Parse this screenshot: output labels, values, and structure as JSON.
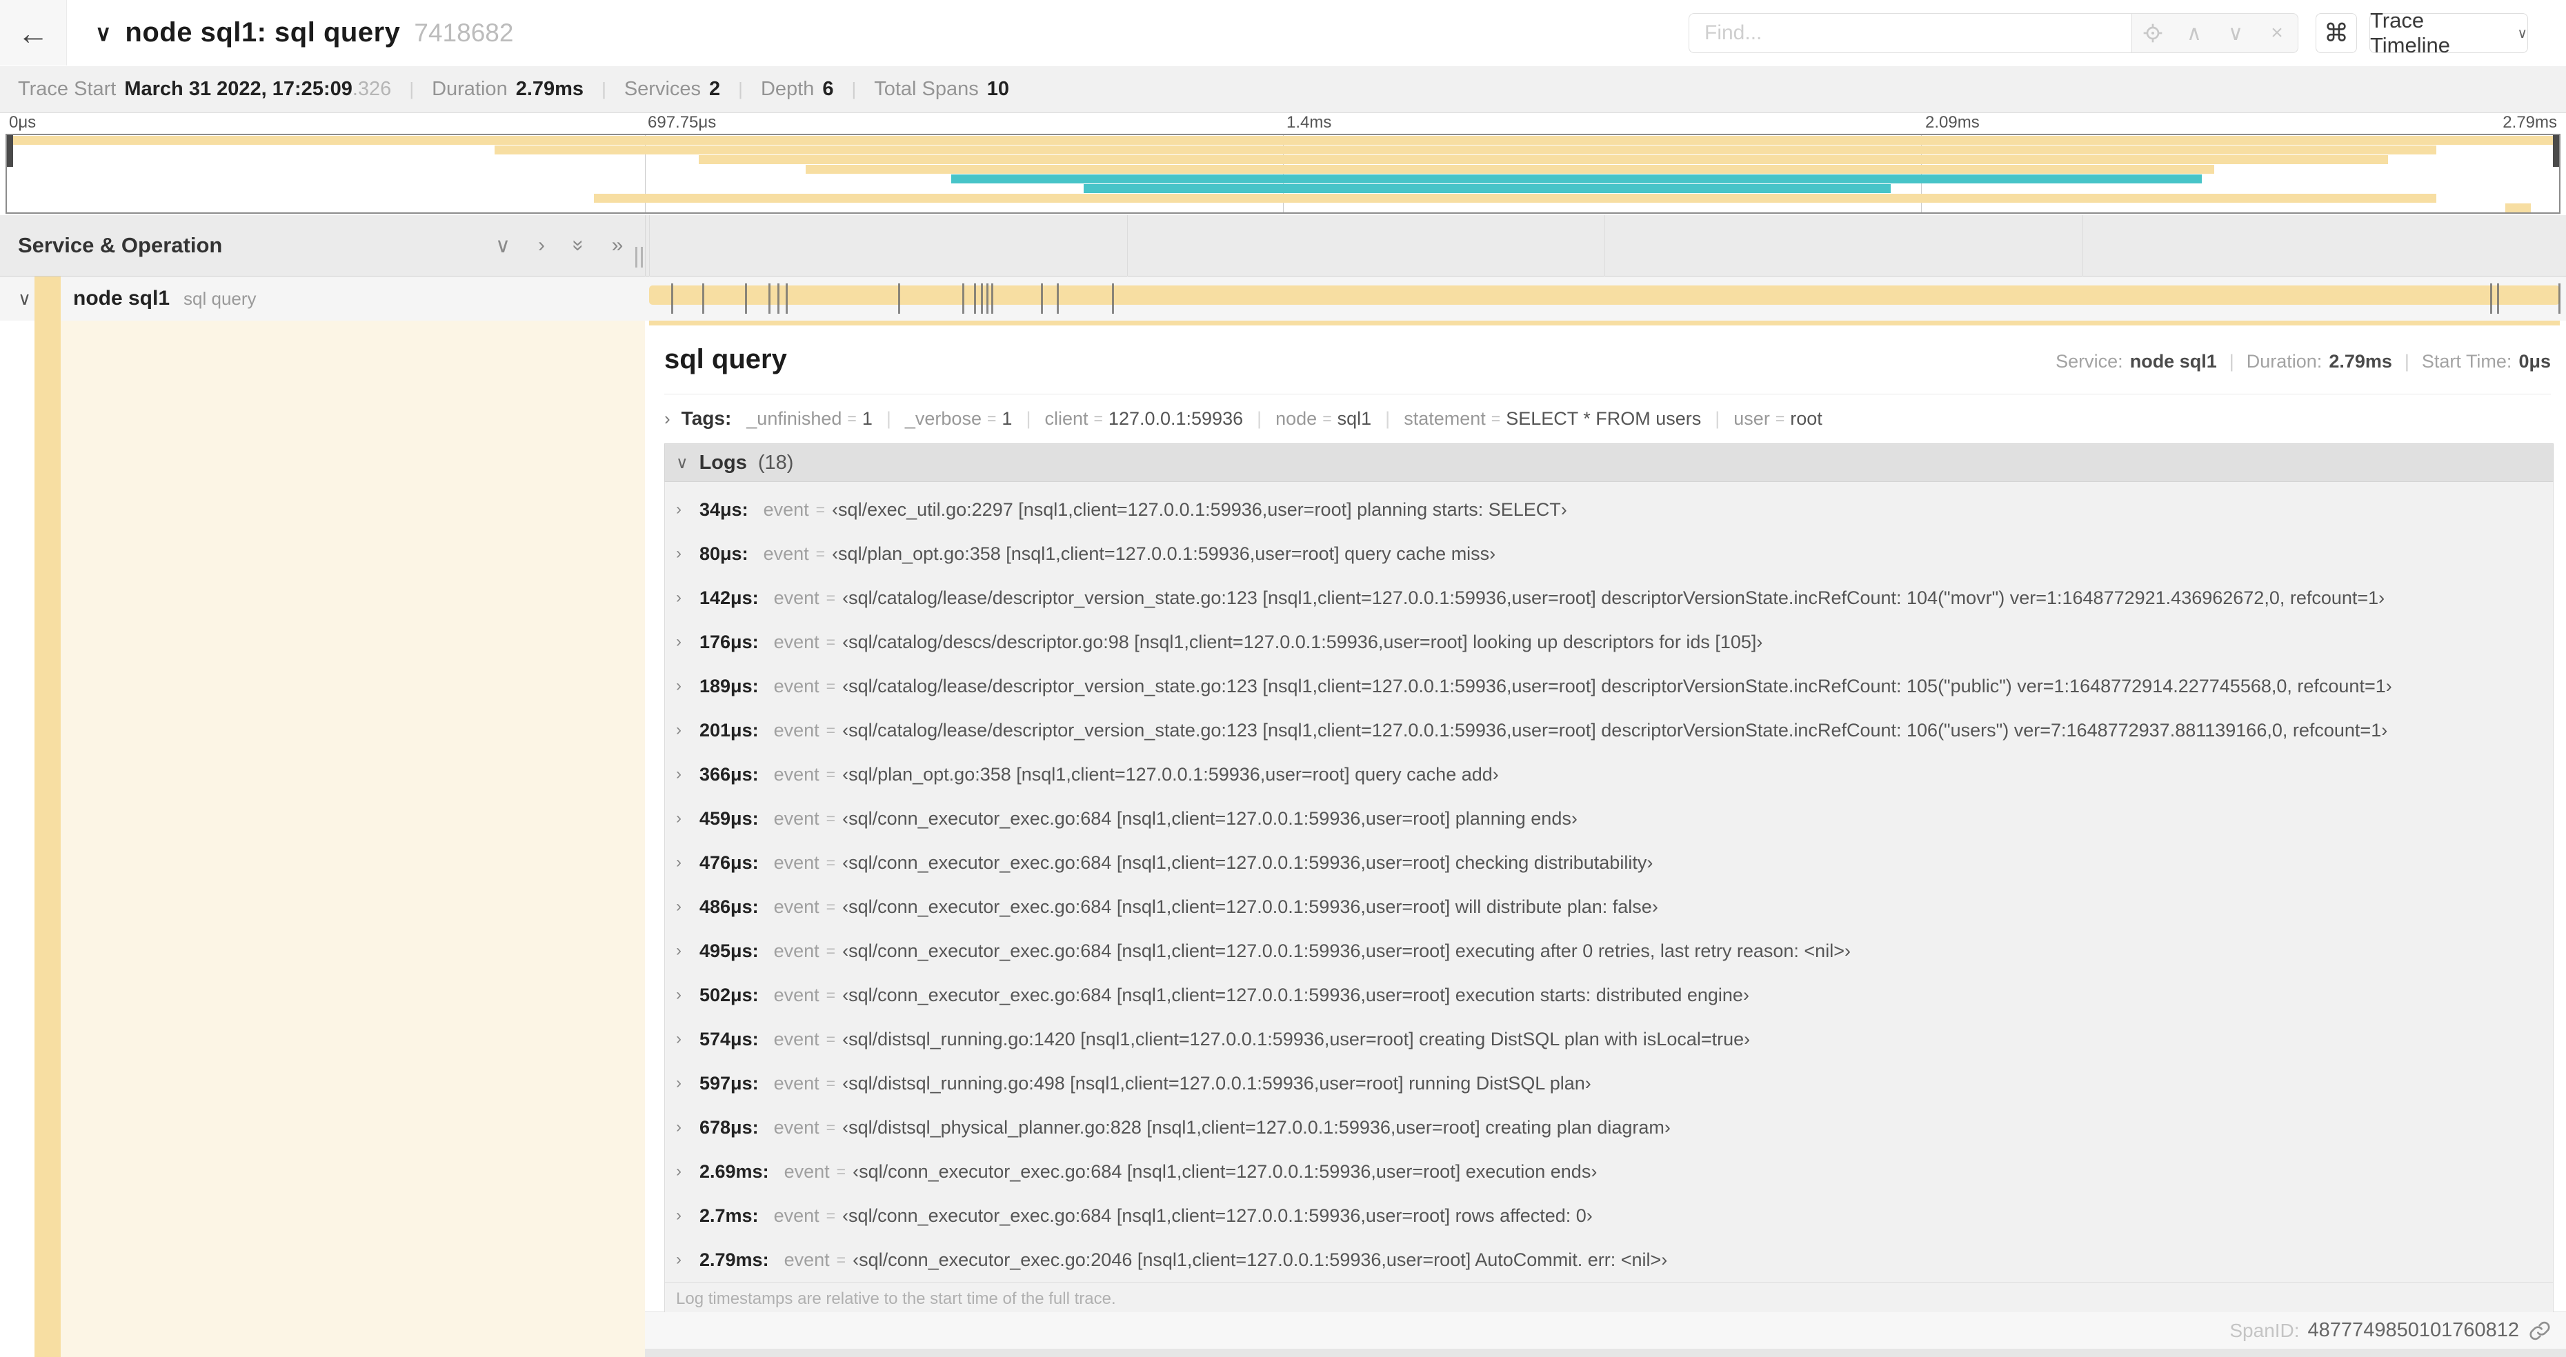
{
  "ui": {
    "sep": "|",
    "eq": "=",
    "back": "←",
    "caret_down": "∨",
    "caret_right": "›",
    "caret_up": "∧",
    "close": "×",
    "double_right": "»",
    "cmd": "⌘"
  },
  "topbar": {
    "title": "node sql1: sql query",
    "trace_id": "7418682",
    "find_placeholder": "Find...",
    "view_selector": "Trace Timeline"
  },
  "trace_summary": {
    "trace_start_label": "Trace Start",
    "trace_start_value": "March 31 2022, 17:25:09",
    "trace_start_suffix": ".326",
    "duration_label": "Duration",
    "duration_value": "2.79ms",
    "services_label": "Services",
    "services_value": "2",
    "depth_label": "Depth",
    "depth_value": "6",
    "total_spans_label": "Total Spans",
    "total_spans_value": "10"
  },
  "timeline": {
    "ticks": [
      "0μs",
      "697.75μs",
      "1.4ms",
      "2.09ms",
      "2.79ms"
    ],
    "duration_us": 2790,
    "log_marker_positions_us": [
      34,
      80,
      142,
      176,
      189,
      201,
      366,
      459,
      476,
      486,
      495,
      502,
      574,
      597,
      678,
      2690,
      2700,
      2790
    ]
  },
  "minimap": {
    "spans": [
      {
        "row": 0,
        "start_pct": 0.2,
        "end_pct": 99.8,
        "color": "tan"
      },
      {
        "row": 1,
        "start_pct": 19.1,
        "end_pct": 95.2,
        "color": "tan"
      },
      {
        "row": 2,
        "start_pct": 27.1,
        "end_pct": 93.3,
        "color": "tan"
      },
      {
        "row": 3,
        "start_pct": 31.3,
        "end_pct": 86.5,
        "color": "tan"
      },
      {
        "row": 4,
        "start_pct": 37.0,
        "end_pct": 86.0,
        "color": "teal"
      },
      {
        "row": 5,
        "start_pct": 42.2,
        "end_pct": 73.8,
        "color": "teal"
      },
      {
        "row": 6,
        "start_pct": 23.0,
        "end_pct": 95.2,
        "color": "tan"
      },
      {
        "row": 7,
        "start_pct": 97.9,
        "end_pct": 98.9,
        "color": "tan"
      }
    ]
  },
  "columns": {
    "header": "Service & Operation"
  },
  "span_row": {
    "service": "node sql1",
    "operation": "sql query"
  },
  "detail": {
    "title": "sql query",
    "service_label": "Service:",
    "service_value": "node sql1",
    "duration_label": "Duration:",
    "duration_value": "2.79ms",
    "start_time_label": "Start Time:",
    "start_time_value": "0μs",
    "tags_label": "Tags:",
    "tags": [
      {
        "key": "_unfinished",
        "value": "1"
      },
      {
        "key": "_verbose",
        "value": "1"
      },
      {
        "key": "client",
        "value": "127.0.0.1:59936"
      },
      {
        "key": "node",
        "value": "sql1"
      },
      {
        "key": "statement",
        "value": "SELECT * FROM users"
      },
      {
        "key": "user",
        "value": "root"
      }
    ],
    "logs_label": "Logs",
    "logs_count": "(18)",
    "log_field": "event",
    "logs": [
      {
        "time": "34μs:",
        "value": "‹sql/exec_util.go:2297 [nsql1,client=127.0.0.1:59936,user=root] planning starts: SELECT›"
      },
      {
        "time": "80μs:",
        "value": "‹sql/plan_opt.go:358 [nsql1,client=127.0.0.1:59936,user=root] query cache miss›"
      },
      {
        "time": "142μs:",
        "value": "‹sql/catalog/lease/descriptor_version_state.go:123 [nsql1,client=127.0.0.1:59936,user=root] descriptorVersionState.incRefCount: 104(\"movr\") ver=1:1648772921.436962672,0, refcount=1›"
      },
      {
        "time": "176μs:",
        "value": "‹sql/catalog/descs/descriptor.go:98 [nsql1,client=127.0.0.1:59936,user=root] looking up descriptors for ids [105]›"
      },
      {
        "time": "189μs:",
        "value": "‹sql/catalog/lease/descriptor_version_state.go:123 [nsql1,client=127.0.0.1:59936,user=root] descriptorVersionState.incRefCount: 105(\"public\") ver=1:1648772914.227745568,0, refcount=1›"
      },
      {
        "time": "201μs:",
        "value": "‹sql/catalog/lease/descriptor_version_state.go:123 [nsql1,client=127.0.0.1:59936,user=root] descriptorVersionState.incRefCount: 106(\"users\") ver=7:1648772937.881139166,0, refcount=1›"
      },
      {
        "time": "366μs:",
        "value": "‹sql/plan_opt.go:358 [nsql1,client=127.0.0.1:59936,user=root] query cache add›"
      },
      {
        "time": "459μs:",
        "value": "‹sql/conn_executor_exec.go:684 [nsql1,client=127.0.0.1:59936,user=root] planning ends›"
      },
      {
        "time": "476μs:",
        "value": "‹sql/conn_executor_exec.go:684 [nsql1,client=127.0.0.1:59936,user=root] checking distributability›"
      },
      {
        "time": "486μs:",
        "value": "‹sql/conn_executor_exec.go:684 [nsql1,client=127.0.0.1:59936,user=root] will distribute plan: false›"
      },
      {
        "time": "495μs:",
        "value": "‹sql/conn_executor_exec.go:684 [nsql1,client=127.0.0.1:59936,user=root] executing after 0 retries, last retry reason: <nil>›"
      },
      {
        "time": "502μs:",
        "value": "‹sql/conn_executor_exec.go:684 [nsql1,client=127.0.0.1:59936,user=root] execution starts: distributed engine›"
      },
      {
        "time": "574μs:",
        "value": "‹sql/distsql_running.go:1420 [nsql1,client=127.0.0.1:59936,user=root] creating DistSQL plan with isLocal=true›"
      },
      {
        "time": "597μs:",
        "value": "‹sql/distsql_running.go:498 [nsql1,client=127.0.0.1:59936,user=root] running DistSQL plan›"
      },
      {
        "time": "678μs:",
        "value": "‹sql/distsql_physical_planner.go:828 [nsql1,client=127.0.0.1:59936,user=root] creating plan diagram›"
      },
      {
        "time": "2.69ms:",
        "value": "‹sql/conn_executor_exec.go:684 [nsql1,client=127.0.0.1:59936,user=root] execution ends›"
      },
      {
        "time": "2.7ms:",
        "value": "‹sql/conn_executor_exec.go:684 [nsql1,client=127.0.0.1:59936,user=root] rows affected: 0›"
      },
      {
        "time": "2.79ms:",
        "value": "‹sql/conn_executor_exec.go:2046 [nsql1,client=127.0.0.1:59936,user=root] AutoCommit. err: <nil>›"
      }
    ],
    "footer_note": "Log timestamps are relative to the start time of the full trace.",
    "span_id_label": "SpanID:",
    "span_id": "4877749850101760812"
  },
  "colors": {
    "span_tan": "#f7dea2",
    "span_teal": "#47c4c8",
    "detail_row_bg": "#fcf5e5"
  }
}
